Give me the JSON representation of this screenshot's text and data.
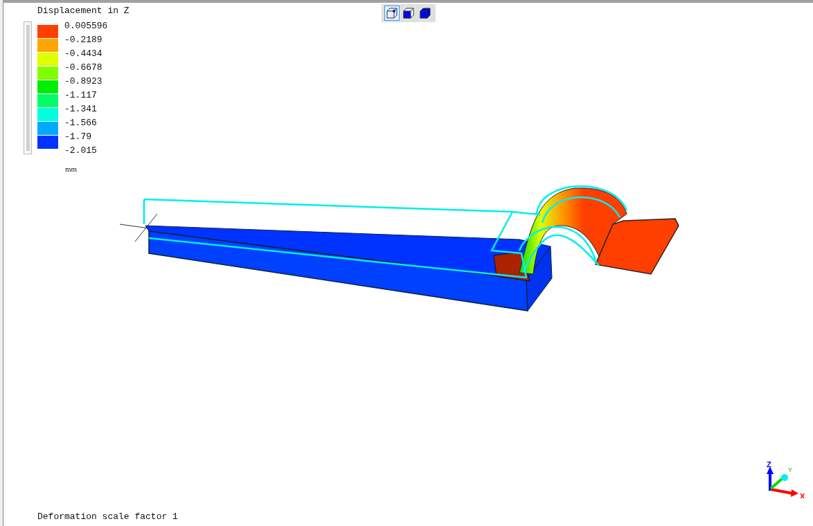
{
  "toolbar": {
    "buttons": [
      {
        "kind": "wireframe",
        "selected": true
      },
      {
        "kind": "shaded-edges",
        "selected": false
      },
      {
        "kind": "shaded",
        "selected": false
      }
    ]
  },
  "legend": {
    "range": {
      "level": 1
    },
    "title": "Displacement in Z",
    "unit": "mm",
    "entries": [
      {
        "value": "0.005596",
        "color": "#ff3f00"
      },
      {
        "value": "-0.2189",
        "color": "#ffa500"
      },
      {
        "value": "-0.4434",
        "color": "#e0ff00"
      },
      {
        "value": "-0.6678",
        "color": "#7fff00"
      },
      {
        "value": "-0.8923",
        "color": "#00ee00"
      },
      {
        "value": "-1.117",
        "color": "#00ff66"
      },
      {
        "value": "-1.341",
        "color": "#00ffdd"
      },
      {
        "value": "-1.566",
        "color": "#00aaff"
      },
      {
        "value": "-1.79",
        "color": "#0033ff"
      }
    ],
    "last_value": "-2.015"
  },
  "axes": {
    "x": "X",
    "y": "Y",
    "z": "Z"
  },
  "status": "Deformation scale factor 1"
}
